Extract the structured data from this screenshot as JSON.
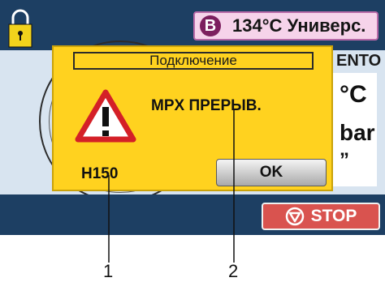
{
  "header": {
    "program_badge": "B",
    "program_label": "134°C Универс."
  },
  "main": {
    "stage_label": "ENTO",
    "right_values": [
      "°C",
      "bar",
      "”"
    ]
  },
  "dialog": {
    "title": "Подключение",
    "message": "MPX ПРЕРЫВ.",
    "error_code": "H150",
    "ok_label": "OK"
  },
  "footer": {
    "stop_label": "STOP"
  },
  "callouts": [
    "1",
    "2"
  ],
  "colors": {
    "bar_background": "#1d3f63",
    "dialog_yellow": "#ffd21f",
    "stop_red": "#d9534f",
    "program_pink": "#f6d3ea",
    "warning_red": "#d42027"
  }
}
